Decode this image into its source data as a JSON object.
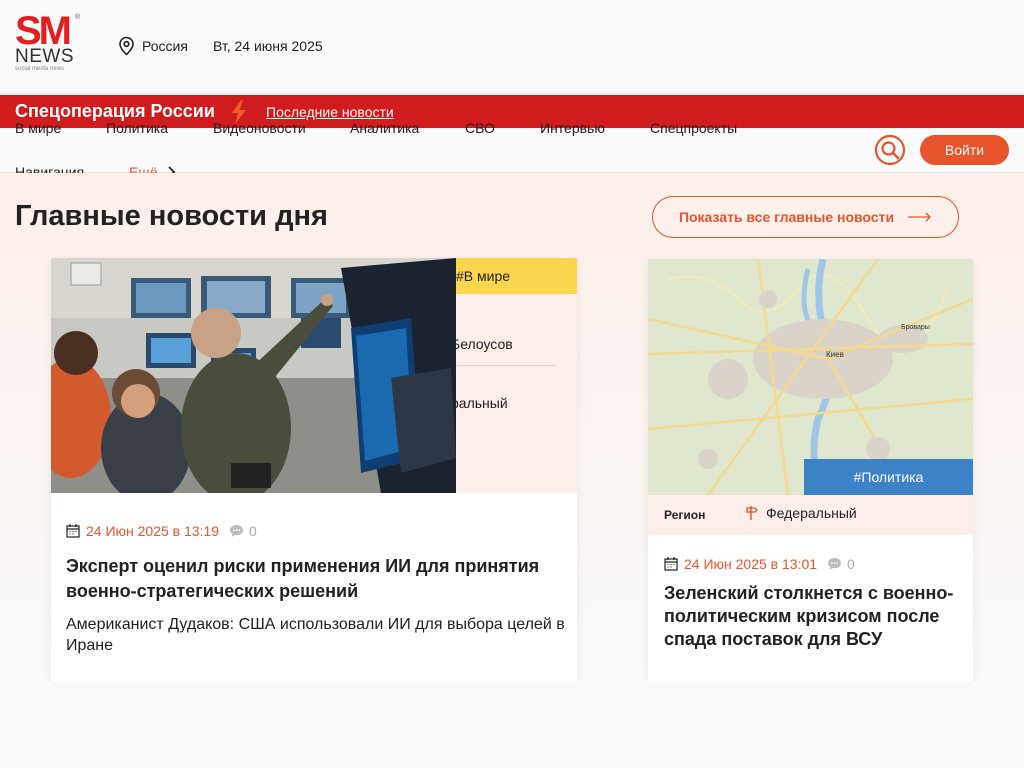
{
  "header": {
    "logo_sm": "SM",
    "logo_news": "NEWS",
    "logo_tagline": "social media news",
    "logo_reg": "®",
    "location": "Россия",
    "date": "Вт, 24 июня 2025"
  },
  "redbar": {
    "title": "Спецоперация России",
    "latest_link": "Последние новости",
    "color": "#d01c1c"
  },
  "nav": {
    "row1": [
      "В мире",
      "Политика",
      "Видеоновости",
      "Аналитика",
      "СВО",
      "Интервью",
      "Спецпроекты"
    ],
    "row2_label": "Навигация",
    "more": "Ещё",
    "login": "Войти",
    "accent": "#e8542c"
  },
  "main": {
    "title": "Главные новости дня",
    "show_all": "Показать все главные новости",
    "cards": [
      {
        "tag": "#В мире",
        "side_1": "Белоусов",
        "side_2": "ральный",
        "date": "24 Июн 2025 в 13:19",
        "comments": "0",
        "title": "Эксперт оценил риски применения ИИ для принятия военно-стратегических решений",
        "subtitle": "Американист Дудаков: США использовали ИИ для выбора целей в Иране"
      },
      {
        "tag": "#Политика",
        "region_label": "Регион",
        "region_value": "Федеральный",
        "date": "24 Июн 2025 в 13:01",
        "comments": "0",
        "title": "Зеленский столкнется с военно-политическим кризисом после спада поставок для ВСУ",
        "map_city": "Киев",
        "map_town": "Бровары"
      }
    ]
  }
}
